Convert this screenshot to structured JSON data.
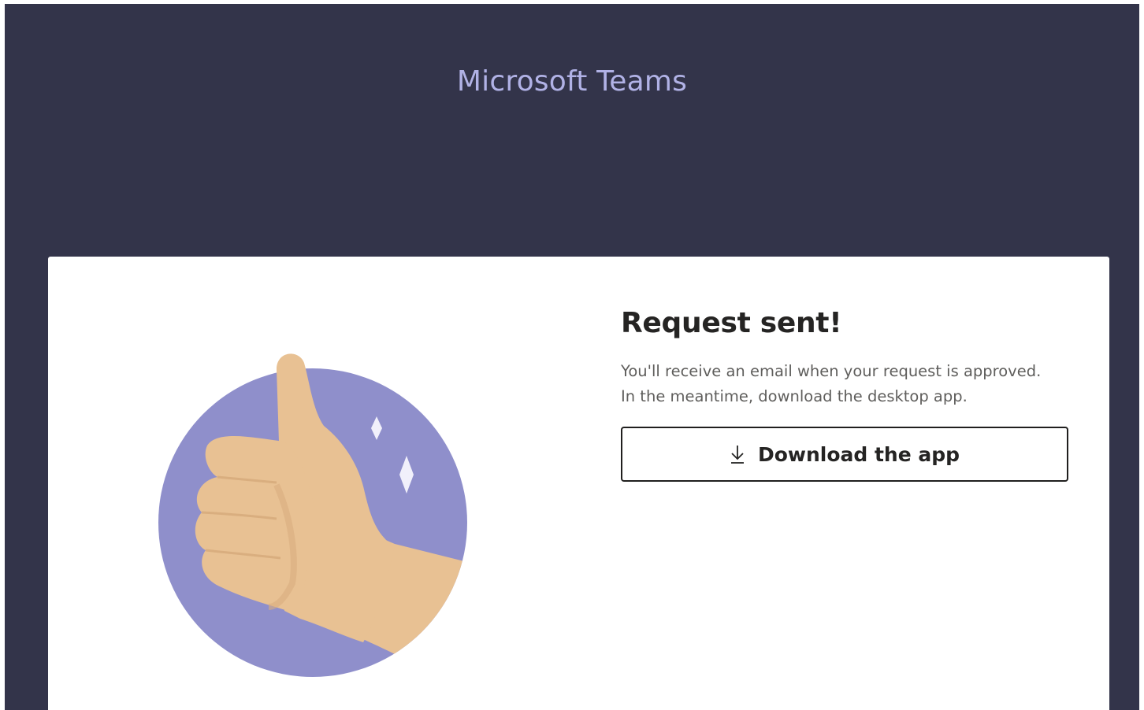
{
  "header": {
    "app_title": "Microsoft Teams"
  },
  "card": {
    "heading": "Request sent!",
    "message_line_1": "You'll receive an email when your request is approved.",
    "message_line_2": "In the meantime, download the desktop app.",
    "download_button_label": "Download the app",
    "download_button_icon": "download-arrow-icon",
    "illustration": "thumbs-up-illustration"
  },
  "colors": {
    "header_background": "#33344a",
    "title_text": "#b1b2e6",
    "card_background": "#ffffff",
    "illustration_circle": "#8f8fcb",
    "illustration_hand": "#e8c193"
  }
}
